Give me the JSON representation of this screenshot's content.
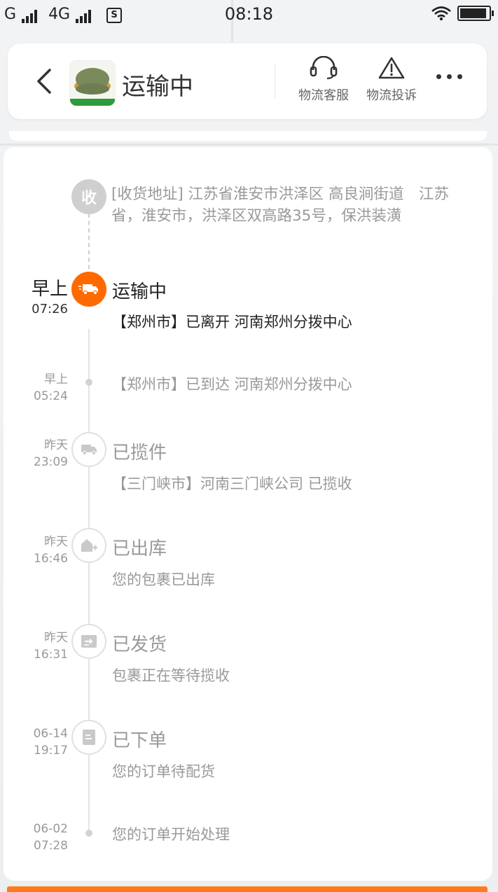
{
  "status_bar": {
    "carrier1": "G",
    "carrier2": "4G",
    "time": "08:18",
    "battery_level": 0.97,
    "sim_icon": "s-box-icon"
  },
  "header": {
    "title": "运输中",
    "actions": [
      {
        "label": "物流客服",
        "icon": "headset-icon"
      },
      {
        "label": "物流投诉",
        "icon": "warning-icon"
      }
    ],
    "accent": "#ff6a00"
  },
  "address": {
    "badge": "收",
    "text": "[收货地址] 江苏省淮安市洪泽区 高良涧街道　江苏省，淮安市，洪泽区双高路35号，保洪装潢"
  },
  "events": [
    {
      "day": "早上",
      "time": "07:26",
      "status": "运输中",
      "desc": "【郑州市】已离开 河南郑州分拨中心",
      "active": true,
      "icon": "truck-icon"
    },
    {
      "day": "早上",
      "time": "05:24",
      "status": "",
      "desc": "【郑州市】已到达 河南郑州分拨中心",
      "active": false
    },
    {
      "day": "昨天",
      "time": "23:09",
      "status": "已揽件",
      "desc": "【三门峡市】河南三门峡公司 已揽收",
      "active": false,
      "icon": "truck-icon"
    },
    {
      "day": "昨天",
      "time": "16:46",
      "status": "已出库",
      "desc": "您的包裹已出库",
      "active": false,
      "icon": "warehouse-out-icon"
    },
    {
      "day": "昨天",
      "time": "16:31",
      "status": "已发货",
      "desc": "包裹正在等待揽收",
      "active": false,
      "icon": "ship-box-icon"
    },
    {
      "day": "06-14",
      "time": "19:17",
      "status": "已下单",
      "desc": "您的订单待配货",
      "active": false,
      "icon": "document-icon"
    },
    {
      "day": "06-02",
      "time": "07:28",
      "status": "",
      "desc": "您的订单开始处理",
      "active": false
    }
  ]
}
